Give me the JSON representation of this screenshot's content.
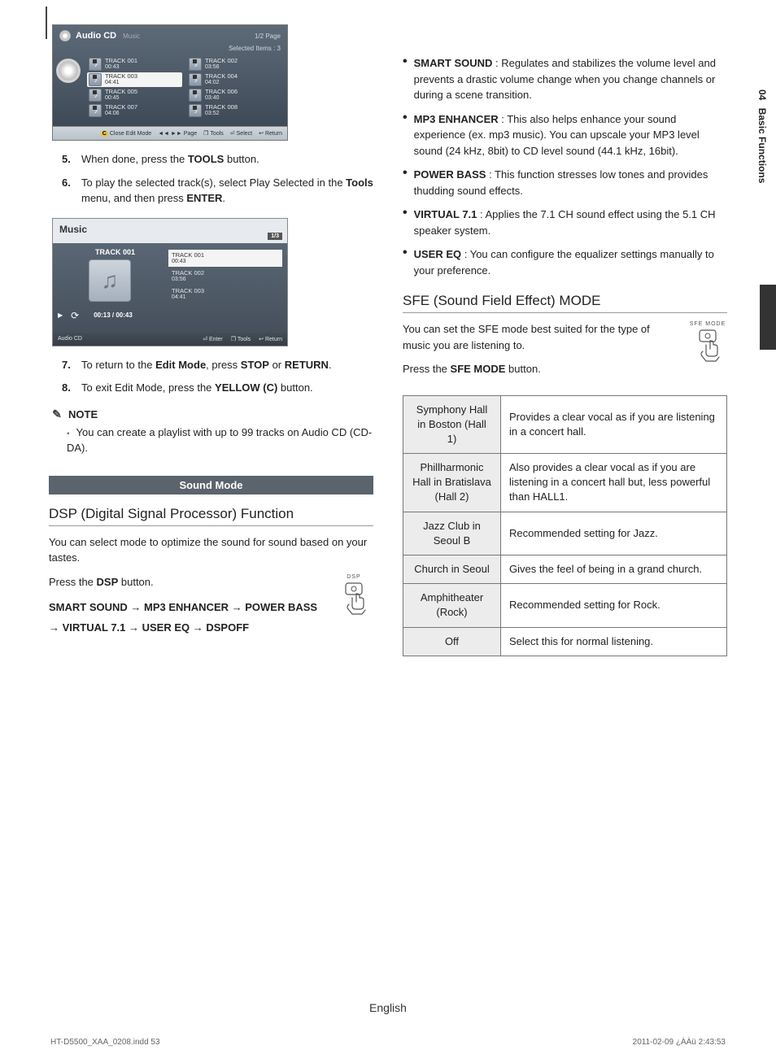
{
  "sideTab": {
    "num": "04",
    "label": "Basic Functions"
  },
  "ui1": {
    "title": "Audio CD",
    "sub": "Music",
    "pageInd": "1/2 Page",
    "selected": "Selected Items : 3",
    "tracksL": [
      {
        "name": "TRACK 001",
        "time": "00:43"
      },
      {
        "name": "TRACK 003",
        "time": "04:41",
        "sel": true
      },
      {
        "name": "TRACK 005",
        "time": "00:45"
      },
      {
        "name": "TRACK 007",
        "time": "04:06"
      }
    ],
    "tracksR": [
      {
        "name": "TRACK 002",
        "time": "03:56"
      },
      {
        "name": "TRACK 004",
        "time": "04:02"
      },
      {
        "name": "TRACK 006",
        "time": "03:40"
      },
      {
        "name": "TRACK 008",
        "time": "03:52"
      }
    ],
    "bottom": {
      "c": "C",
      "close": "Close Edit Mode",
      "page": "◄◄ ►► Page",
      "tools": "Tools",
      "select": "Select",
      "return": "Return"
    }
  },
  "steps1": [
    {
      "n": "5.",
      "pre": "When done, press the ",
      "b": "TOOLS",
      "post": " button."
    },
    {
      "n": "6.",
      "pre": "To play the selected track(s), select Play Selected in the ",
      "b": "Tools",
      "post": " menu, and then press ",
      "b2": "ENTER",
      "post2": "."
    }
  ],
  "ui2": {
    "head": "Music",
    "pg": "1/3",
    "now": "TRACK 001",
    "time": "00:13 / 00:43",
    "list": [
      {
        "name": "TRACK 001",
        "time": "00:43",
        "sel": true
      },
      {
        "name": "TRACK 002",
        "time": "03:56"
      },
      {
        "name": "TRACK 003",
        "time": "04:41"
      }
    ],
    "src": "Audio CD",
    "cmds": {
      "enter": "Enter",
      "tools": "Tools",
      "return": "Return"
    }
  },
  "steps2": [
    {
      "n": "7.",
      "pre": "To return to the ",
      "b": "Edit Mode",
      "post": ", press ",
      "b2": "STOP",
      "post2": " or ",
      "b3": "RETURN",
      "post3": "."
    },
    {
      "n": "8.",
      "pre": "To exit Edit Mode, press the ",
      "b": "YELLOW (C)",
      "post": " button."
    }
  ],
  "noteHead": "NOTE",
  "noteItem": "You can create a playlist with up to 99 tracks on Audio CD (CD-DA).",
  "band": "Sound Mode",
  "dspHead": "DSP (Digital Signal Processor) Function",
  "dspPara": "You can select mode to optimize the sound for sound based on your tastes.",
  "dspPressPre": "Press the ",
  "dspPressB": "DSP",
  "dspPressPost": " button.",
  "dspBtnLbl": "DSP",
  "chain": "SMART SOUND → MP3 ENHANCER → POWER BASS →  VIRTUAL 7.1 → USER EQ → DSPOFF",
  "feats": [
    {
      "b": "SMART SOUND",
      "t": " : Regulates and stabilizes the volume level and prevents a drastic volume change when you change channels or during a scene transition."
    },
    {
      "b": "MP3 ENHANCER",
      "t": " : This also helps enhance your sound experience (ex. mp3 music). You can upscale your MP3 level sound (24 kHz, 8bit) to CD level sound (44.1 kHz, 16bit)."
    },
    {
      "b": "POWER BASS",
      "t": " : This function stresses low tones and provides thudding sound effects."
    },
    {
      "b": "VIRTUAL 7.1",
      "t": " : Applies the 7.1 CH sound effect using the 5.1 CH speaker system."
    },
    {
      "b": "USER EQ",
      "t": " : You can configure the equalizer settings manually to your preference."
    }
  ],
  "sfeHead": "SFE (Sound Field Effect) MODE",
  "sfePara": "You can set the SFE mode best suited for the type of music you are listening to.",
  "sfePressPre": "Press the ",
  "sfePressB": "SFE MODE",
  "sfePressPost": " button.",
  "sfeBtnLbl": "SFE MODE",
  "sfeTable": [
    {
      "k": "Symphony Hall in Boston (Hall 1)",
      "v": "Provides a clear vocal as if you are listening in a concert hall."
    },
    {
      "k": "Phillharmonic Hall in Bratislava (Hall 2)",
      "v": "Also provides a clear vocal as if you are listening in a concert hall but, less powerful than HALL1."
    },
    {
      "k": "Jazz Club in Seoul B",
      "v": "Recommended setting for Jazz."
    },
    {
      "k": "Church in Seoul",
      "v": "Gives the feel of being in a grand church."
    },
    {
      "k": "Amphitheater (Rock)",
      "v": "Recommended setting for Rock."
    },
    {
      "k": "Off",
      "v": "Select this for normal listening."
    }
  ],
  "eng": "English",
  "footL": "HT-D5500_XAA_0208.indd   53",
  "footR": "2011-02-09   ¿ÀÀü 2:43:53"
}
